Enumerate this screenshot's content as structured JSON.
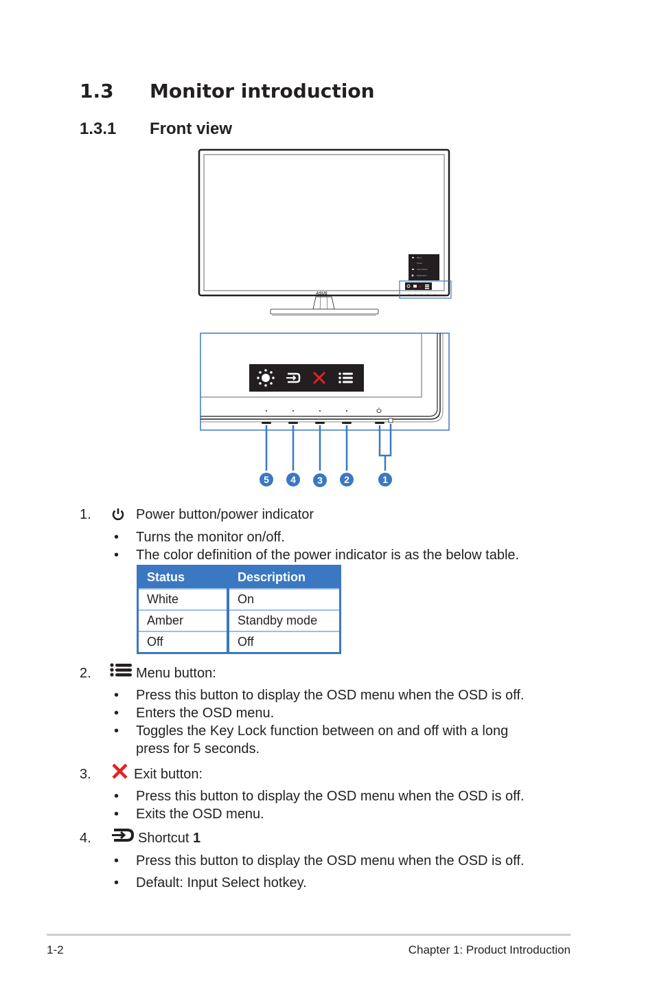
{
  "section": {
    "number": "1.3",
    "title": "Monitor introduction"
  },
  "subsection": {
    "number": "1.3.1",
    "title": "Front view"
  },
  "figure": {
    "osd_menu_items": [
      "Menu",
      "Close",
      "Input Select",
      "Brightness"
    ],
    "brand_logo": "ASUS",
    "key_icons": [
      "brightness-icon",
      "input-select-icon",
      "close-icon",
      "menu-icon"
    ],
    "callouts": [
      "5",
      "4",
      "3",
      "2",
      "1"
    ],
    "accent_color": "#3a78c2",
    "exit_color": "#e32227"
  },
  "items": [
    {
      "number": "1.",
      "icon": "power-icon",
      "label": "Power button/power indicator",
      "bullets": [
        "Turns the monitor on/off.",
        "The color definition of the power indicator is as the below table."
      ],
      "table": {
        "headers": [
          "Status",
          "Description"
        ],
        "rows": [
          [
            "White",
            "On"
          ],
          [
            "Amber",
            "Standby mode"
          ],
          [
            "Off",
            "Off"
          ]
        ]
      }
    },
    {
      "number": "2.",
      "icon": "menu-icon",
      "label": "Menu button:",
      "bullets": [
        "Press this button to display the OSD menu when the OSD is off.",
        "Enters the OSD menu.",
        "Toggles the Key Lock function between on and off with a long",
        "press for 5 seconds."
      ]
    },
    {
      "number": "3.",
      "icon": "close-icon",
      "label": "Exit button:",
      "bullets": [
        "Press this button to display the OSD menu when the OSD is off.",
        "Exits the OSD menu."
      ]
    },
    {
      "number": "4.",
      "icon": "input-select-icon",
      "label": "Shortcut ",
      "label_bold": "1",
      "bullets": [
        "Press this button to display the OSD menu when the OSD is off.",
        "Default: Input Select hotkey."
      ]
    }
  ],
  "footer": {
    "page": "1-2",
    "chapter": "Chapter 1: Product Introduction"
  }
}
